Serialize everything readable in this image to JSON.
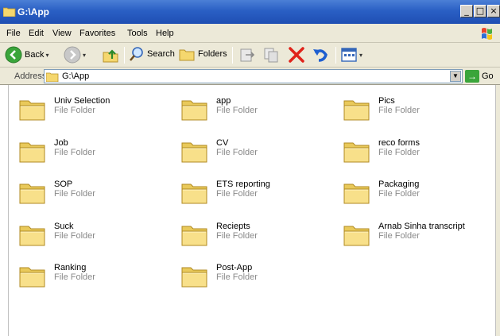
{
  "window": {
    "title": "G:\\App"
  },
  "menu": {
    "items": [
      "File",
      "Edit",
      "View",
      "Favorites",
      "Tools",
      "Help"
    ]
  },
  "toolbar": {
    "back_label": "Back",
    "search_label": "Search",
    "folders_label": "Folders"
  },
  "address": {
    "label": "Address",
    "value": "G:\\App",
    "go_label": "Go"
  },
  "folders": [
    {
      "name": "Univ Selection",
      "type": "File Folder"
    },
    {
      "name": "app",
      "type": "File Folder"
    },
    {
      "name": "Pics",
      "type": "File Folder"
    },
    {
      "name": "Job",
      "type": "File Folder"
    },
    {
      "name": "CV",
      "type": "File Folder"
    },
    {
      "name": "reco forms",
      "type": "File Folder"
    },
    {
      "name": "SOP",
      "type": "File Folder"
    },
    {
      "name": "ETS reporting",
      "type": "File Folder"
    },
    {
      "name": "Packaging",
      "type": "File Folder"
    },
    {
      "name": "Suck",
      "type": "File Folder"
    },
    {
      "name": "Reciepts",
      "type": "File Folder"
    },
    {
      "name": "Arnab Sinha transcript",
      "type": "File Folder"
    },
    {
      "name": "Ranking",
      "type": "File Folder"
    },
    {
      "name": "Post-App",
      "type": "File Folder"
    }
  ]
}
